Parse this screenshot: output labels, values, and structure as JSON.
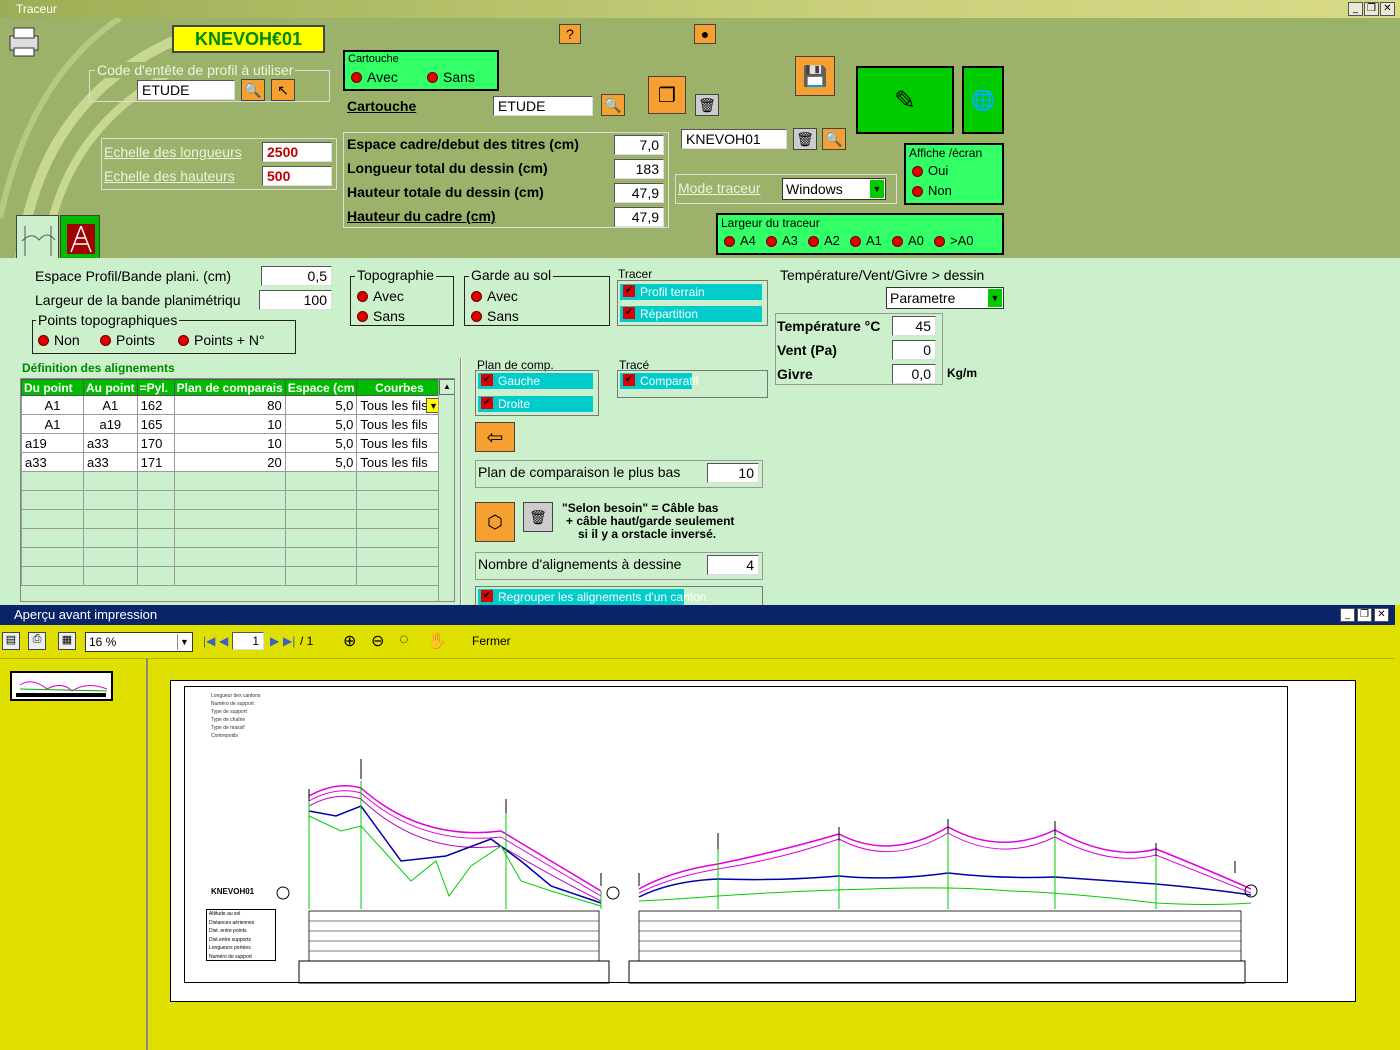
{
  "window": {
    "title": "Traceur",
    "min": "_",
    "restore": "❐",
    "close": "✕"
  },
  "header": {
    "profile_code": "KNEVOH€01"
  },
  "code_entete": {
    "label": "Code d'entête de profil à utiliser",
    "value": "ETUDE"
  },
  "cartouche_group": {
    "title": "Cartouche",
    "options": [
      "Avec",
      "Sans"
    ]
  },
  "cartouche_field": {
    "label": "Cartouche",
    "value": "ETUDE"
  },
  "echelle": {
    "longueurs_label": "Echelle des longueurs",
    "longueurs_value": "2500",
    "hauteurs_label": "Echelle des hauteurs",
    "hauteurs_value": "500"
  },
  "dims": {
    "rows": [
      {
        "label": "Espace cadre/debut des titres (cm)",
        "value": "7,0"
      },
      {
        "label": "Longueur total du dessin (cm)",
        "value": "183"
      },
      {
        "label": "Hauteur totale du dessin (cm)",
        "value": "47,9"
      },
      {
        "label": "Hauteur du cadre (cm)",
        "value": "47,9"
      }
    ]
  },
  "knevoh_field": "KNEVOH01",
  "mode_traceur": {
    "label": "Mode traceur",
    "value": "Windows"
  },
  "affiche": {
    "title": "Affiche /écran",
    "options": [
      "Oui",
      "Non"
    ]
  },
  "largeur_traceur": {
    "title": "Largeur du traceur",
    "options": [
      "A4",
      "A3",
      "A2",
      "A1",
      "A0",
      ">A0"
    ]
  },
  "lower": {
    "espace_profil": {
      "label": "Espace Profil/Bande plani. (cm)",
      "value": "0,5"
    },
    "largeur_bande": {
      "label": "Largeur de la bande planimétriqu",
      "value": "100"
    },
    "points_topo": {
      "title": "Points topographiques",
      "options": [
        "Non",
        "Points",
        "Points + N°"
      ]
    },
    "topographie": {
      "title": "Topographie",
      "options": [
        "Avec",
        "Sans"
      ]
    },
    "garde_sol": {
      "title": "Garde au sol",
      "options": [
        "Avec",
        "Sans"
      ]
    },
    "tracer": {
      "title": "Tracer",
      "items": [
        "Profil terrain",
        "Répartition"
      ]
    },
    "temp": {
      "title": "Température/Vent/Givre > dessin",
      "select": "Parametre",
      "temperature_label": "Température °C",
      "temperature_value": "45",
      "vent_label": "Vent (Pa)",
      "vent_value": "0",
      "givre_label": "Givre",
      "givre_value": "0,0",
      "givre_unit": "Kg/m"
    },
    "plan_comp": {
      "title": "Plan de comp.",
      "items": [
        "Gauche",
        "Droite"
      ]
    },
    "trace": {
      "title": "Tracé",
      "items": [
        "Comparatif"
      ]
    },
    "plan_bas": {
      "label": "Plan de comparaison le plus bas",
      "value": "10"
    },
    "note": [
      "\"Selon besoin\" = Câble bas",
      "+ câble haut/garde seulement",
      "si il y a orstacle inversé."
    ],
    "nombre_align": {
      "label": "Nombre d'alignements à dessine",
      "value": "4"
    },
    "regrouper": "Regrouper les alignements d'un canton"
  },
  "alignements": {
    "title": "Définition des alignements",
    "columns": [
      "Du point",
      "Au point",
      "=Pyl.",
      "Plan de comparais",
      "Espace (cm",
      "Courbes"
    ],
    "rows": [
      [
        "A1",
        "A1",
        "162",
        "80",
        "5,0",
        "Tous les fils"
      ],
      [
        "A1",
        "a19",
        "165",
        "10",
        "5,0",
        "Tous les fils"
      ],
      [
        "a19",
        "a33",
        "170",
        "10",
        "5,0",
        "Tous les fils"
      ],
      [
        "a33",
        "a33",
        "171",
        "20",
        "5,0",
        "Tous les fils"
      ]
    ]
  },
  "preview": {
    "title": "Aperçu avant impression",
    "zoom": "16 %",
    "page": "1",
    "pages": "/ 1",
    "close_label": "Fermer",
    "drawing_code": "KNEVOH01",
    "legend_top": [
      "Longueur des cantons",
      "Numéro de support",
      "Type de support",
      "Type de chaîne",
      "Type de massif",
      "Contrepoids"
    ],
    "legend_bottom": [
      "Altitude au sol",
      "Distances aériennes",
      "Dist. entre points",
      "Dist.entre supports",
      "Longueurs portées",
      "Numéro de support"
    ]
  },
  "colors": {
    "app_bg": "#9cb26a",
    "lower_bg": "#ccf0cc",
    "preview_bg": "#e0e000",
    "accent_green": "#33ff66"
  }
}
